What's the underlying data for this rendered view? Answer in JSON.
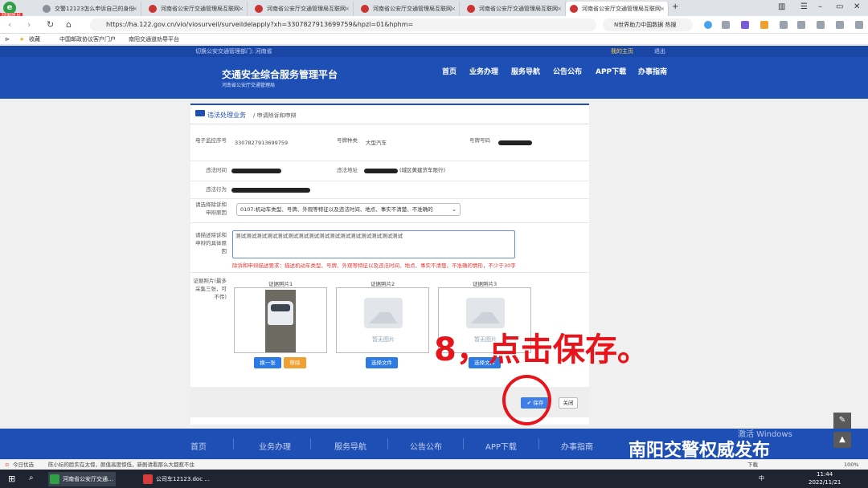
{
  "browser": {
    "logo": "e",
    "badge": "绿屏账号",
    "tabs": [
      {
        "label": "交警12123怎么申诉自己的身份"
      },
      {
        "label": "河南省公安厅交通管理局互联网"
      },
      {
        "label": "河南省公安厅交通管理局互联网"
      },
      {
        "label": "河南省公安厅交通管理局互联网"
      },
      {
        "label": "河南省公安厅交通管理局互联网"
      },
      {
        "label": "河南省公安厅交通管理局互联网"
      }
    ],
    "url": "https://ha.122.gov.cn/vio/viosurveil/surveildelapply?xh=3307827913699759&hpzl=01&hphm=",
    "search_text": "N世界助力中国数据 热搜",
    "bookmarks": [
      "收藏",
      "中国邮政协议客户门户",
      "南阳交通道劝导平台"
    ]
  },
  "site": {
    "top_left": "切换公安交通管理部门: 河南省",
    "top_right": [
      "我的主页",
      "退出"
    ],
    "title": "交通安全综合服务管理平台",
    "subtitle": "河南省公安厅交通管理局",
    "nav": [
      "首页",
      "业务办理",
      "服务导航",
      "公告公布",
      "APP下载",
      "办事指南"
    ]
  },
  "page": {
    "section_title": "违法处理业务",
    "breadcrumb": "/ 申请除诉和申辩",
    "fields": {
      "monitor_no_label": "电子监控序号",
      "monitor_no_value": "3307827913699759",
      "plate_type_label": "号牌种类",
      "plate_type_value": "大型汽车",
      "plate_no_label": "号牌号码",
      "time_label": "违法时间",
      "place_label": "违法地址",
      "place_value": "(城区黄建货车限行)",
      "act_label": "违法行为",
      "reason_label": "请选择除诉和申辩原因",
      "reason_value": "0107:机动车类型、号牌、外观等特征以及违法时间、地点、事实不清楚、不准确的",
      "desc_label": "请描述除诉和申辩的具体原因",
      "desc_value": "测试测试测试测试测试测试测试测试测试测试测试测试测试测试测试测试",
      "desc_hint": "除诉和申辩描述要求：描述机动车类型、号牌、外观等特征以及违法时间、地点、事实不清楚、不准确的情形，不少于30字",
      "photos_label": "证据照片(最多采集三张，可不传)"
    },
    "photos": [
      {
        "caption": "证据照片1",
        "buttons": [
          "换一张",
          "移除"
        ]
      },
      {
        "caption": "证据照片2",
        "empty_text": "暂无图片",
        "buttons": [
          "选择文件"
        ]
      },
      {
        "caption": "证据照片3",
        "empty_text": "暂无图片",
        "buttons": [
          "选择文件"
        ]
      }
    ],
    "annotation": "8，点击保存。",
    "save_label": "保存",
    "close_label": "关闭"
  },
  "footer": {
    "nav": [
      "首页",
      "业务办理",
      "服务导航",
      "公告公布",
      "APP下载",
      "办事指南"
    ],
    "watermark": "南阳交警权威发布",
    "windows_activate": "激活 Windows"
  },
  "statusbar": {
    "left": "今日优选",
    "news": "陈小纭的脸实在太惊，颜值高度惊低，新剧请看那么大都惹不住",
    "zoom": "100%",
    "download": "下载"
  },
  "taskbar": {
    "tasks": [
      "河南省公安厅交通...",
      "公司车12123.doc ..."
    ],
    "time": "11:44",
    "date": "2022/11/21",
    "ime": "中"
  },
  "colors": {
    "brand": "#1e4fb5",
    "annotation": "#e8141b",
    "save": "#3d7fe6"
  }
}
